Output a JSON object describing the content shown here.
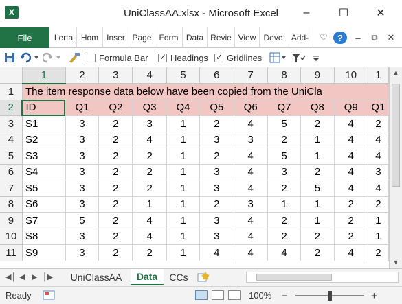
{
  "window": {
    "title": "UniClassAA.xlsx - Microsoft Excel",
    "app_icon": "X",
    "minimize": "–",
    "maximize": "☐",
    "close": "✕"
  },
  "ribbon": {
    "file_tab": "File",
    "tabs": [
      "Lerta",
      "Hom",
      "Inser",
      "Page",
      "Form",
      "Data",
      "Revie",
      "View",
      "Deve",
      "Add-"
    ],
    "right_icons": [
      "♡",
      "?",
      "–",
      "⧉",
      "✕"
    ]
  },
  "qat": {
    "formula_bar_label": "Formula Bar",
    "headings_label": "Headings",
    "gridlines_label": "Gridlines",
    "formula_bar_checked": false,
    "headings_checked": true,
    "gridlines_checked": true
  },
  "columns": [
    "1",
    "2",
    "3",
    "4",
    "5",
    "6",
    "7",
    "8",
    "9",
    "10",
    "1"
  ],
  "rows": [
    {
      "n": "1",
      "cells": [
        "The item response data below have been copied from the UniCla"
      ]
    },
    {
      "n": "2",
      "cells": [
        "ID",
        "Q1",
        "Q2",
        "Q3",
        "Q4",
        "Q5",
        "Q6",
        "Q7",
        "Q8",
        "Q9",
        "Q1"
      ]
    },
    {
      "n": "3",
      "cells": [
        "S1",
        "3",
        "2",
        "3",
        "1",
        "2",
        "4",
        "5",
        "2",
        "4",
        "2"
      ]
    },
    {
      "n": "4",
      "cells": [
        "S2",
        "3",
        "2",
        "4",
        "1",
        "3",
        "3",
        "2",
        "1",
        "4",
        "4"
      ]
    },
    {
      "n": "5",
      "cells": [
        "S3",
        "3",
        "2",
        "2",
        "1",
        "2",
        "4",
        "5",
        "1",
        "4",
        "4"
      ]
    },
    {
      "n": "6",
      "cells": [
        "S4",
        "3",
        "2",
        "2",
        "1",
        "3",
        "4",
        "3",
        "2",
        "4",
        "3"
      ]
    },
    {
      "n": "7",
      "cells": [
        "S5",
        "3",
        "2",
        "2",
        "1",
        "3",
        "4",
        "2",
        "5",
        "4",
        "4"
      ]
    },
    {
      "n": "8",
      "cells": [
        "S6",
        "3",
        "2",
        "1",
        "1",
        "2",
        "3",
        "1",
        "1",
        "2",
        "2"
      ]
    },
    {
      "n": "9",
      "cells": [
        "S7",
        "5",
        "2",
        "4",
        "1",
        "3",
        "4",
        "2",
        "1",
        "2",
        "1"
      ]
    },
    {
      "n": "10",
      "cells": [
        "S8",
        "3",
        "2",
        "4",
        "1",
        "3",
        "4",
        "2",
        "2",
        "2",
        "1"
      ]
    },
    {
      "n": "11",
      "cells": [
        "S9",
        "3",
        "2",
        "2",
        "1",
        "4",
        "4",
        "4",
        "2",
        "4",
        "2"
      ]
    }
  ],
  "sheets": [
    "UniClassAA",
    "Data",
    "CCs"
  ],
  "active_sheet": "Data",
  "status": {
    "ready": "Ready",
    "zoom": "100%",
    "zoom_out": "−",
    "zoom_in": "+"
  }
}
